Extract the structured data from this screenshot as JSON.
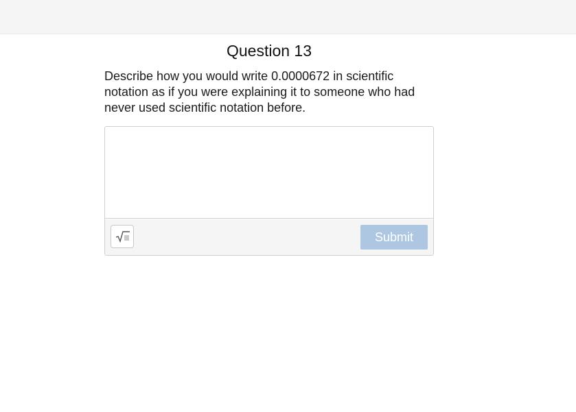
{
  "question": {
    "title": "Question 13",
    "text": "Describe how you would write 0.0000672 in scientific notation as if you were explaining it to someone who had never used scientific notation before."
  },
  "answer": {
    "value": "",
    "placeholder": "",
    "math_icon": "square-root-icon",
    "submit_label": "Submit",
    "submit_enabled": false
  },
  "colors": {
    "top_bar": "#f5f5f5",
    "submit_disabled": "#adc6e2",
    "border": "#cfcfcf"
  }
}
